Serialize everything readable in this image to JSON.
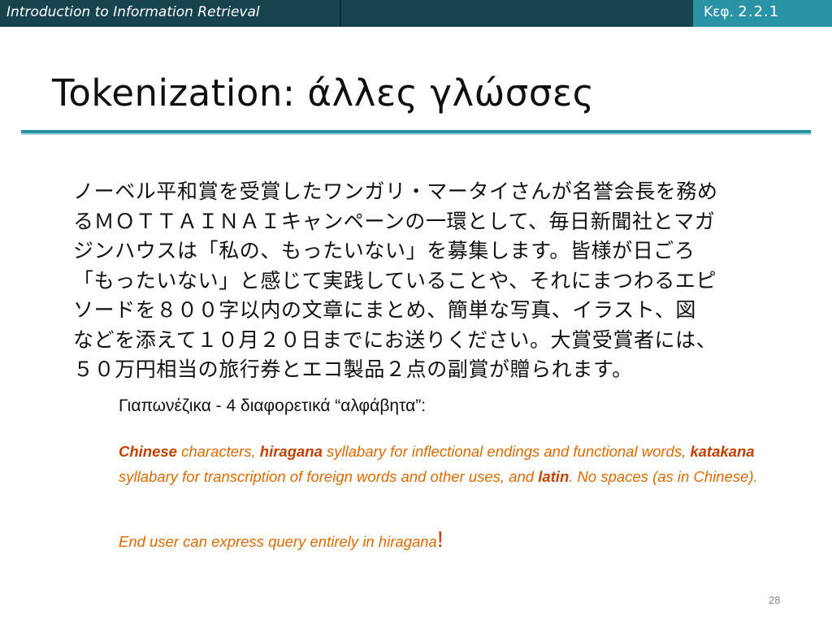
{
  "header": {
    "course": "Introduction to Information Retrieval",
    "chapter_prefix": "Κεφ.",
    "chapter_number": "2.2.1"
  },
  "title": "Tokenization: άλλες γλώσσες",
  "japanese_text": [
    "ノーベル平和賞を受賞したワンガリ・マータイさんが名誉会長を務め",
    "るＭＯＴＴＡＩＮＡＩキャンペーンの一環として、毎日新聞社とマガ",
    "ジンハウスは「私の、もったいない」を募集します。皆様が日ごろ",
    "「もったいない」と感じて実践していることや、それにまつわるエピ",
    "ソードを８００字以内の文章にまとめ、簡単な写真、イラスト、図",
    "などを添えて１０月２０日までにお送りください。大賞受賞者には、",
    "５０万円相当の旅行券とエコ製品２点の副賞が贈られます。"
  ],
  "subheading": "Γιαπωνέζικα - 4 διαφορετικά “αλφάβητα”:",
  "body": {
    "chinese": "Chinese",
    "t1": " characters, ",
    "hiragana": "hiragana",
    "t2": " syllabary for inflectional endings and functional words, ",
    "katakana": "katakana",
    "t3": " syllabary for transcription of foreign words and other uses, and ",
    "latin": "latin",
    "t4": ". No spaces (as in Chinese)."
  },
  "end_user": "End user can express query  entirely in hiragana",
  "exclaim": "!",
  "page_number": "28"
}
